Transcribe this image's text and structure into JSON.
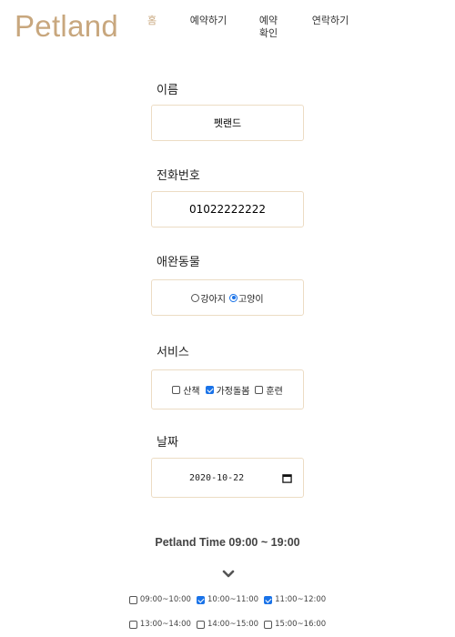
{
  "header": {
    "logo": "Petland",
    "nav": [
      {
        "label": "홈",
        "active": true
      },
      {
        "label": "예약하기",
        "active": false
      },
      {
        "label": "예약\n확인",
        "active": false
      },
      {
        "label": "연락하기",
        "active": false
      }
    ]
  },
  "form": {
    "name_label": "이름",
    "name_value": "펫랜드",
    "phone_label": "전화번호",
    "phone_value": "01022222222",
    "pet_label": "애완동물",
    "pet_options": [
      {
        "label": "강아지",
        "checked": false
      },
      {
        "label": "고양이",
        "checked": true
      }
    ],
    "service_label": "서비스",
    "services": [
      {
        "label": "산책",
        "checked": false
      },
      {
        "label": "가정돌봄",
        "checked": true
      },
      {
        "label": "훈련",
        "checked": false
      }
    ],
    "date_label": "날짜",
    "date_value": "2020-10-22",
    "date_icon": "calendar-icon"
  },
  "time": {
    "title": "Petland Time 09:00 ~ 19:00",
    "toggle_icon": "chevron-down-icon",
    "slots_row1": [
      {
        "label": "09:00~10:00",
        "checked": false
      },
      {
        "label": "10:00~11:00",
        "checked": true
      },
      {
        "label": "11:00~12:00",
        "checked": true
      }
    ],
    "slots_row2": [
      {
        "label": "13:00~14:00",
        "checked": false
      },
      {
        "label": "14:00~15:00",
        "checked": false
      },
      {
        "label": "15:00~16:00",
        "checked": false
      }
    ]
  },
  "colors": {
    "accent": "#c8a77e",
    "border": "#ecdcc4",
    "check": "#1a73e8"
  }
}
